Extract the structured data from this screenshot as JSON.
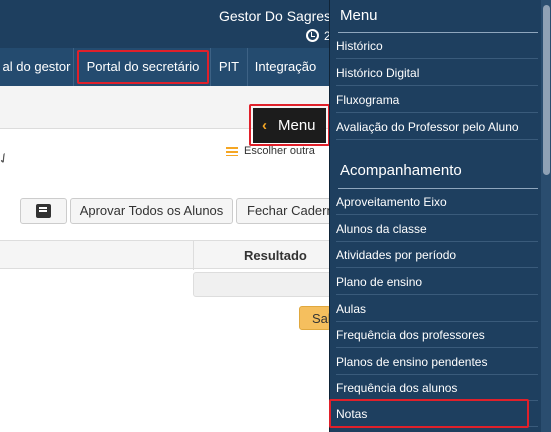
{
  "header": {
    "user_name": "Gestor Do Sagres",
    "clock_text": "2"
  },
  "nav": {
    "items": [
      {
        "label": "al do gestor"
      },
      {
        "label": "Portal do secretário"
      },
      {
        "label": "PIT"
      },
      {
        "label": "Integração"
      }
    ]
  },
  "toolbar": {
    "escolher_label": "Escolher outra",
    "aprovar_label": "Aprovar Todos os Alunos",
    "fechar_label": "Fechar Cadern",
    "save_label": "Sal"
  },
  "table": {
    "resultado_header": "Resultado"
  },
  "menu_toggle": {
    "label": "Menu"
  },
  "side_menu": {
    "title": "Menu",
    "items": [
      {
        "label": "Histórico"
      },
      {
        "label": "Histórico Digital"
      },
      {
        "label": "Fluxograma"
      },
      {
        "label": "Avaliação do Professor pelo Aluno"
      }
    ],
    "section2_title": "Acompanhamento",
    "acompanhamento_items": [
      {
        "label": "Aproveitamento Eixo"
      },
      {
        "label": "Alunos da classe"
      },
      {
        "label": "Atividades por período"
      },
      {
        "label": "Plano de ensino"
      },
      {
        "label": "Aulas"
      },
      {
        "label": "Frequência dos professores"
      },
      {
        "label": "Planos de ensino pendentes"
      },
      {
        "label": "Frequência dos alunos"
      },
      {
        "label": "Notas"
      }
    ]
  },
  "colors": {
    "highlight": "#e0202a",
    "navy": "#1e3f5f",
    "accent": "#f5a623"
  }
}
